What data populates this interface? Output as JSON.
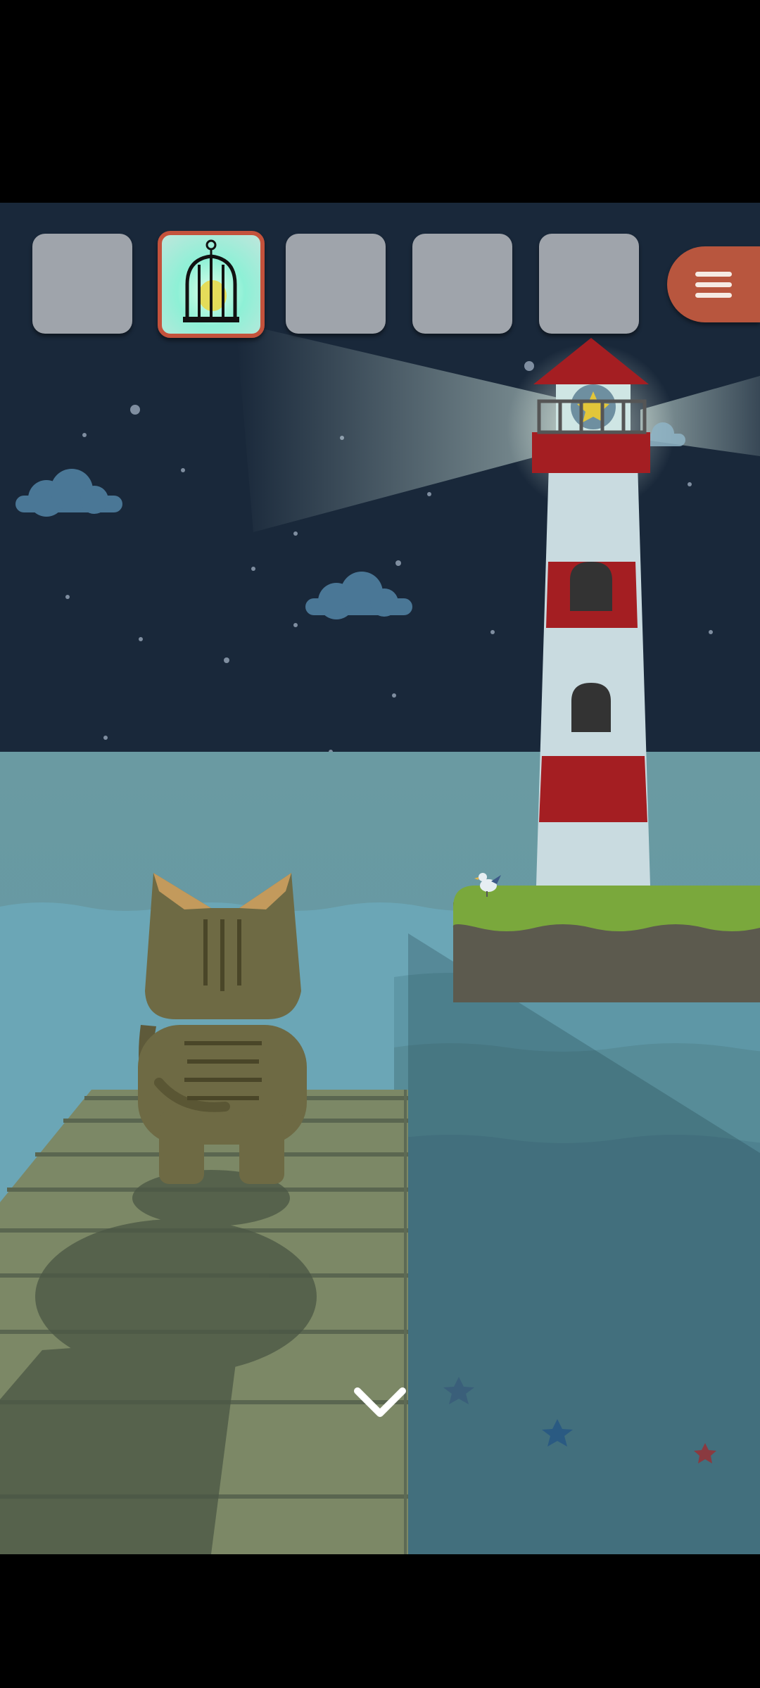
{
  "screen": {
    "background": "#000000",
    "sky_color": "#19283a",
    "sea_color": "#6aa0a8",
    "pier_color": "#7c8866"
  },
  "inventory": {
    "slots": [
      {
        "item": "",
        "selected": false
      },
      {
        "item": "birdcage-lantern",
        "selected": true
      },
      {
        "item": "",
        "selected": false
      },
      {
        "item": "",
        "selected": false
      },
      {
        "item": "",
        "selected": false
      }
    ],
    "slot_color": "#9fa4ab",
    "selected_border_color": "#c4523c"
  },
  "menu": {
    "icon": "hamburger-icon",
    "color": "#b8563e"
  },
  "navigation": {
    "icon": "chevron-down-icon"
  },
  "scene_objects": [
    "lighthouse",
    "cat",
    "wooden-pier",
    "seagull",
    "clouds",
    "starfish"
  ]
}
